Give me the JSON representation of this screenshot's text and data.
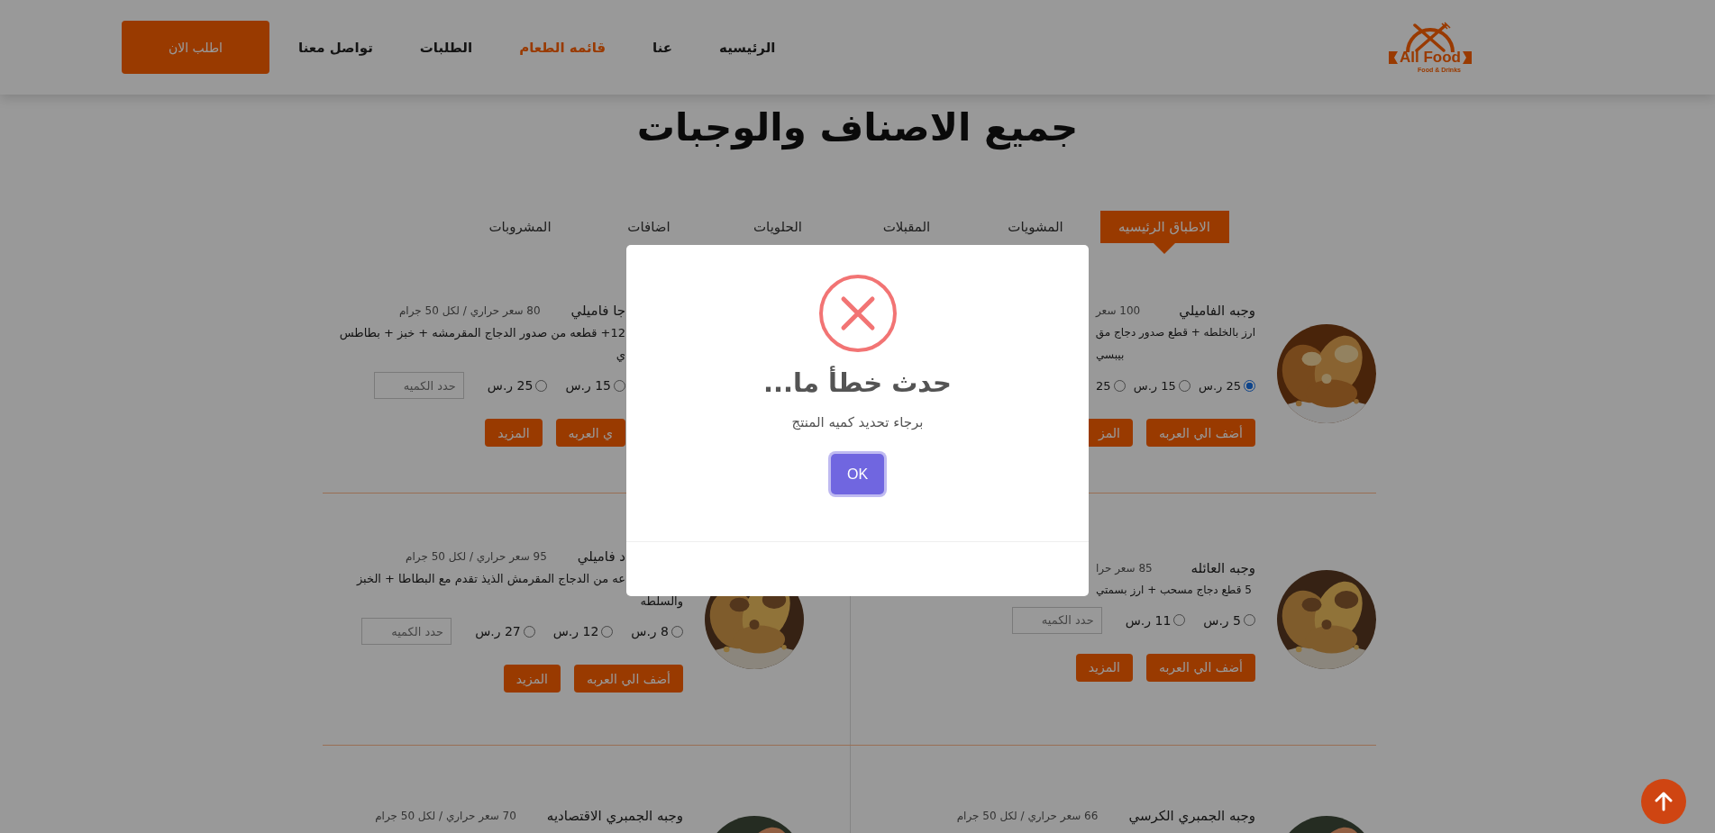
{
  "header": {
    "logo": {
      "name": "All Food",
      "tagline": "Food & Drinks"
    },
    "nav": [
      {
        "label": "الرئيسيه",
        "selected": false
      },
      {
        "label": "عنا",
        "selected": false
      },
      {
        "label": "قائمه الطعام",
        "selected": true
      },
      {
        "label": "الطلبات",
        "selected": false
      },
      {
        "label": "تواصل معنا",
        "selected": false
      }
    ],
    "order_button": "اطلب الان"
  },
  "page_title": "جميع الاصناف والوجبات",
  "tabs": [
    {
      "label": "الاطباق الرئيسيه",
      "selected": true
    },
    {
      "label": "المشويات",
      "selected": false
    },
    {
      "label": "المقبلات",
      "selected": false
    },
    {
      "label": "الحلويات",
      "selected": false
    },
    {
      "label": "اضافات",
      "selected": false
    },
    {
      "label": "المشروبات",
      "selected": false
    }
  ],
  "rows": [
    [
      {
        "title": "وجبه الفاميلي",
        "calories": "100 سعر",
        "lines": [
          "ارز بالخلطه + قطع صدور دجاج مق",
          "بيبسي"
        ],
        "options": [
          {
            "label": "25 ر.س",
            "selected": true
          },
          {
            "label": "15 ر.س",
            "selected": false
          },
          {
            "label": "25",
            "selected": false
          }
        ],
        "buttons": [
          "أضف الي العربه",
          "المز"
        ],
        "photo": {
          "kind": "picture"
        }
      },
      {
        "title": "جا فاميلي",
        "calories": "80 سعر حراري / لكل 50 جرام",
        "lines": [
          "12+ قطعه من صدور الدجاج المقرمشه + خبز + بطاطس",
          "ي"
        ],
        "options": [
          {
            "label": "15 ر.س",
            "selected": false
          },
          {
            "label": "25 ر.س",
            "selected": false
          }
        ],
        "quantity": {
          "placeholder": "حدد الكميه"
        },
        "buttons": [
          "ي العربه",
          "المزيد"
        ]
      }
    ],
    [
      {
        "title": "وجبه العائله",
        "calories": "85 سعر حرا",
        "lines": [
          "5 قطع دجاج مسحب + ارز بسمتي"
        ],
        "options": [
          {
            "label": "5 ر.س",
            "selected": false
          },
          {
            "label": "11 ر.س",
            "selected": false
          }
        ],
        "quantity": {
          "placeholder": "حدد الكميه"
        },
        "buttons": [
          "أضف الي العربه",
          "المزيد"
        ],
        "photo": {
          "kind": "picture"
        }
      },
      {
        "title": "د فاميلي",
        "calories": "95 سعر حراري / لكل 50 جرام",
        "lines": [
          "عه من الدجاج المقرمش الذيذ تقدم مع البطاطا + الخبز",
          "والسلطه"
        ],
        "options": [
          {
            "label": "8 ر.س",
            "selected": false
          },
          {
            "label": "12 ر.س",
            "selected": false
          },
          {
            "label": "27 ر.س",
            "selected": false
          }
        ],
        "quantity": {
          "placeholder": "حدد الكميه"
        },
        "buttons": [
          "أضف الي العربه",
          "المزيد"
        ],
        "photo": {
          "kind": "picture"
        }
      }
    ],
    [
      {
        "title": "وجبه الجمبري الكرسي",
        "calories": "66 سعر حراري / لكل 50 جرام",
        "photo": {
          "kind": "picture"
        }
      },
      {
        "title": "وجبه الجمبري الاقتصاديه",
        "calories": "70 سعر حراري / لكل 50 جرام",
        "photo": {
          "kind": "picture"
        }
      }
    ]
  ],
  "dialog": {
    "title": "حدث خطأ ما...",
    "message": "برجاء تحديد كميه المنتج",
    "button": "OK"
  }
}
